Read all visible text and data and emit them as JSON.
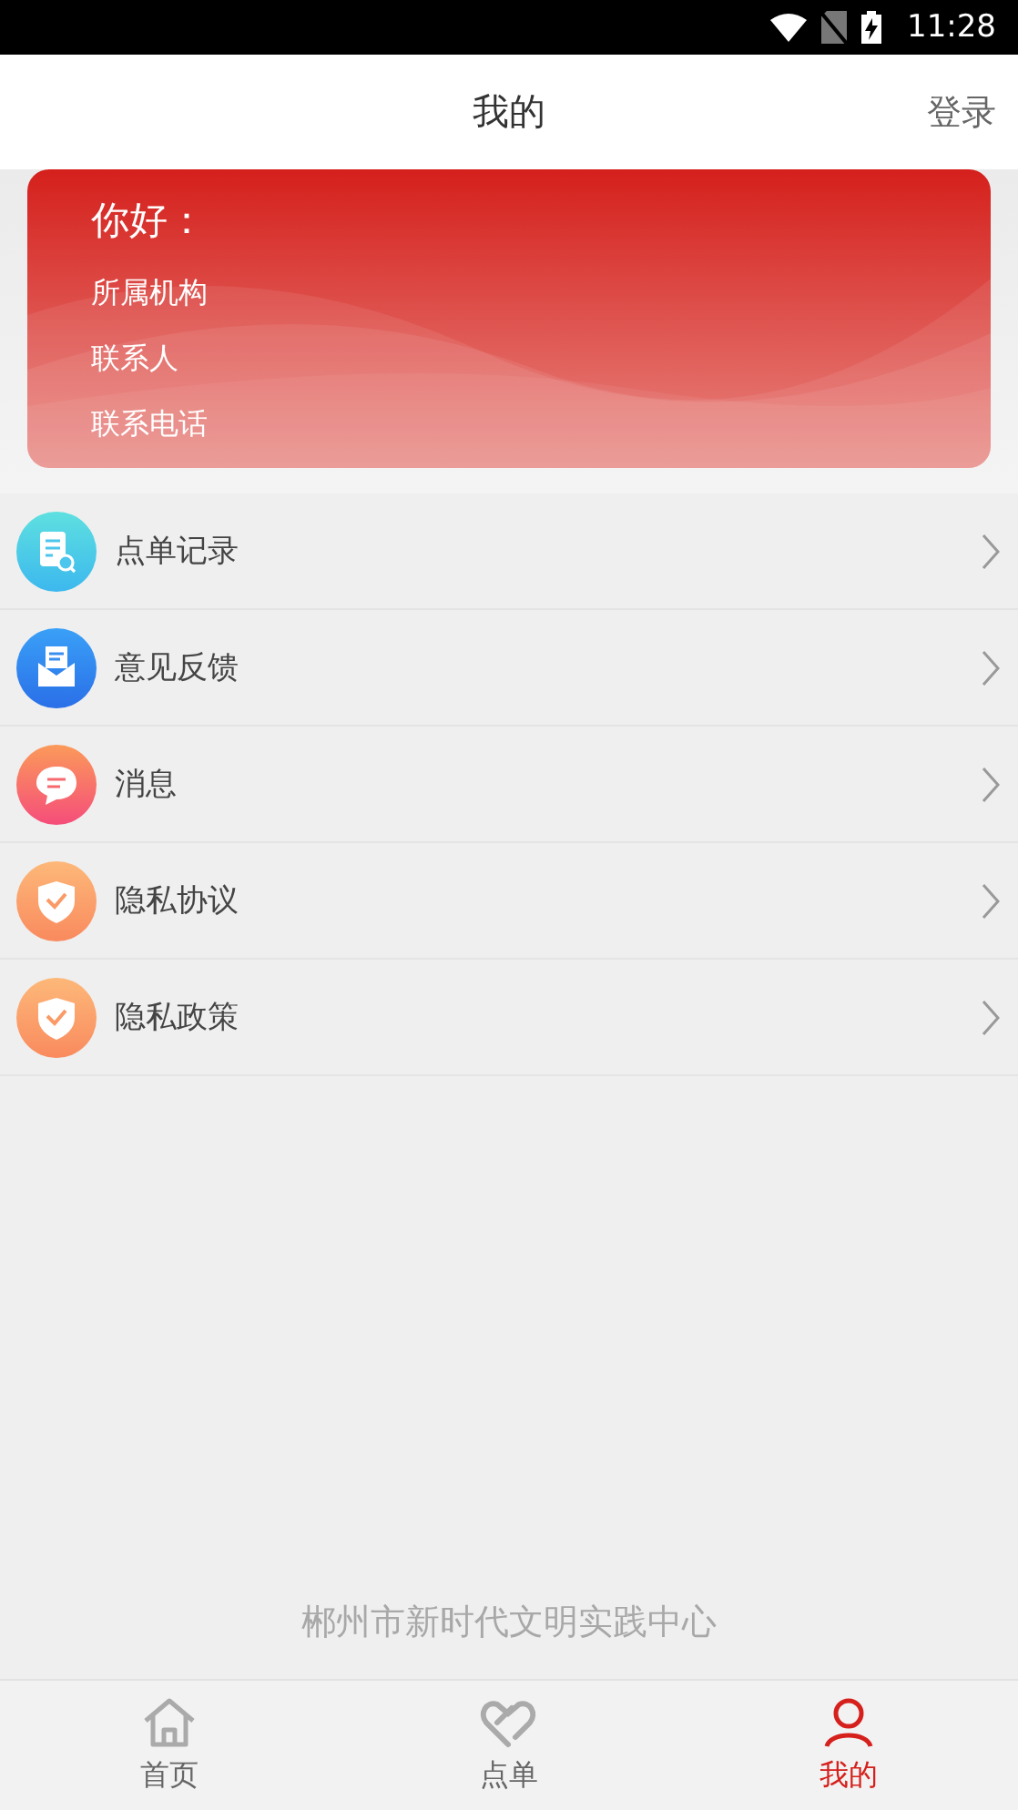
{
  "status_bar": {
    "time": "11:28"
  },
  "header": {
    "title": "我的",
    "action": "登录"
  },
  "profile_card": {
    "greeting": "你好：",
    "fields": [
      "所属机构",
      "联系人",
      "联系电话"
    ]
  },
  "menu": [
    {
      "label": "点单记录",
      "kind": "record"
    },
    {
      "label": "意见反馈",
      "kind": "mail"
    },
    {
      "label": "消息",
      "kind": "chat"
    },
    {
      "label": "隐私协议",
      "kind": "shield"
    },
    {
      "label": "隐私政策",
      "kind": "shield"
    }
  ],
  "footer": "郴州市新时代文明实践中心",
  "tabs": [
    {
      "label": "首页",
      "kind": "home",
      "selected": false
    },
    {
      "label": "点单",
      "kind": "heart",
      "selected": false
    },
    {
      "label": "我的",
      "kind": "person",
      "selected": true
    }
  ]
}
